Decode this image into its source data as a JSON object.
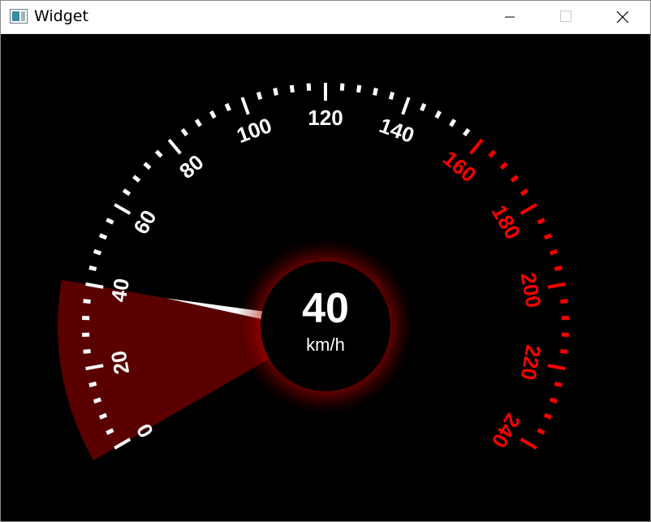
{
  "window": {
    "title": "Widget"
  },
  "gauge": {
    "speed_value": "40",
    "unit": "km/h",
    "min": 0,
    "max": 240,
    "current": 40,
    "red_zone_start": 160,
    "tick_labels": [
      "0",
      "20",
      "40",
      "60",
      "80",
      "100",
      "120",
      "140",
      "160",
      "180",
      "200",
      "220",
      "240"
    ],
    "colors": {
      "normal_scale": "#ffffff",
      "red_scale": "#ff0000",
      "background": "#000000",
      "sector": "#5a0000",
      "needle": "#ffffff",
      "center_glow": "#d00000"
    }
  }
}
